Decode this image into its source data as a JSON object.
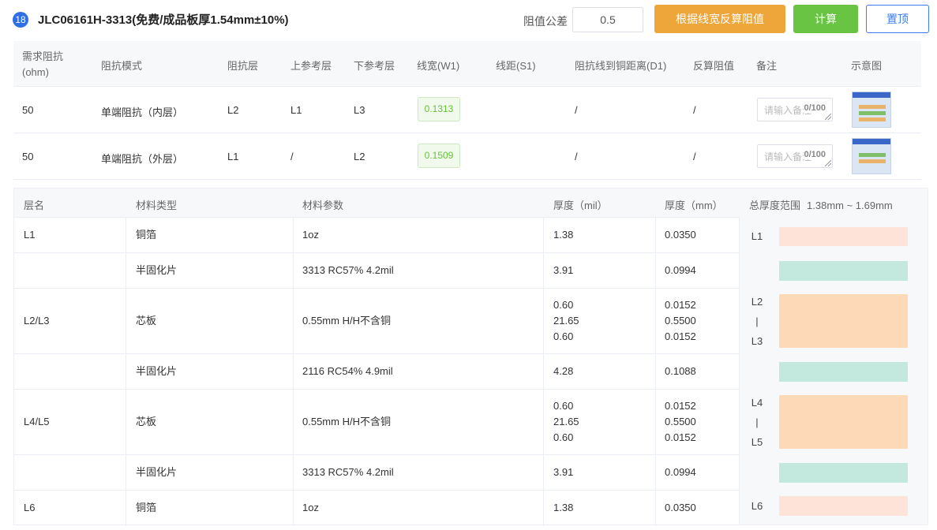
{
  "header": {
    "badge": "18",
    "title": "JLC06161H-3313(免费/成品板厚1.54mm±10%)",
    "tolerance_label": "阻值公差",
    "tolerance_value": "0.5",
    "btn_reverse": "根据线宽反算阻值",
    "btn_calc": "计算",
    "btn_top": "置顶"
  },
  "impedance": {
    "headers": {
      "req": "需求阻抗(ohm)",
      "mode": "阻抗模式",
      "layer": "阻抗层",
      "top_ref": "上参考层",
      "bottom_ref": "下参考层",
      "width": "线宽(W1)",
      "spacing": "线距(S1)",
      "d1": "阻抗线到铜距离(D1)",
      "reverse": "反算阻值",
      "note": "备注",
      "diagram": "示意图"
    },
    "rows": [
      {
        "req": "50",
        "mode": "单端阻抗（内层）",
        "layer": "L2",
        "top_ref": "L1",
        "bottom_ref": "L3",
        "width": "0.1313",
        "spacing": "",
        "d1": "/",
        "reverse": "/",
        "note_placeholder": "请输入备注",
        "note_count": "0/100"
      },
      {
        "req": "50",
        "mode": "单端阻抗（外层）",
        "layer": "L1",
        "top_ref": "/",
        "bottom_ref": "L2",
        "width": "0.1509",
        "spacing": "",
        "d1": "/",
        "reverse": "/",
        "note_placeholder": "请输入备注",
        "note_count": "0/100"
      }
    ]
  },
  "stackup": {
    "headers": {
      "layer": "层名",
      "type": "材料类型",
      "param": "材料参数",
      "mil": "厚度（mil）",
      "mm": "厚度（mm）"
    },
    "rows": [
      {
        "layer": "L1",
        "type": "铜箔",
        "param": "1oz",
        "mil": "1.38",
        "mm": "0.0350"
      },
      {
        "layer": "",
        "type": "半固化片",
        "param": "3313 RC57% 4.2mil",
        "mil": "3.91",
        "mm": "0.0994"
      },
      {
        "layer": "L2/L3",
        "type": "芯板",
        "param": "0.55mm H/H不含铜",
        "mil": [
          "0.60",
          "21.65",
          "0.60"
        ],
        "mm": [
          "0.0152",
          "0.5500",
          "0.0152"
        ]
      },
      {
        "layer": "",
        "type": "半固化片",
        "param": "2116 RC54% 4.9mil",
        "mil": "4.28",
        "mm": "0.1088"
      },
      {
        "layer": "L4/L5",
        "type": "芯板",
        "param": "0.55mm H/H不含铜",
        "mil": [
          "0.60",
          "21.65",
          "0.60"
        ],
        "mm": [
          "0.0152",
          "0.5500",
          "0.0152"
        ]
      },
      {
        "layer": "",
        "type": "半固化片",
        "param": "3313 RC57% 4.2mil",
        "mil": "3.91",
        "mm": "0.0994"
      },
      {
        "layer": "L6",
        "type": "铜箔",
        "param": "1oz",
        "mil": "1.38",
        "mm": "0.0350"
      }
    ]
  },
  "visual": {
    "title": "总厚度范围",
    "range": "1.38mm ~ 1.69mm",
    "labels": {
      "l1": "L1",
      "l2": "L2",
      "l3": "L3",
      "l4": "L4",
      "l5": "L5",
      "l6": "L6",
      "sep": "|"
    },
    "colors": {
      "copper": "#fde3d8",
      "prepreg": "#c3e8de",
      "core": "#fed9b8"
    }
  },
  "colors": {
    "accent_blue": "#3d7df0",
    "orange": "#eea63a",
    "green": "#69c444",
    "pill_green": "#67c23a"
  }
}
